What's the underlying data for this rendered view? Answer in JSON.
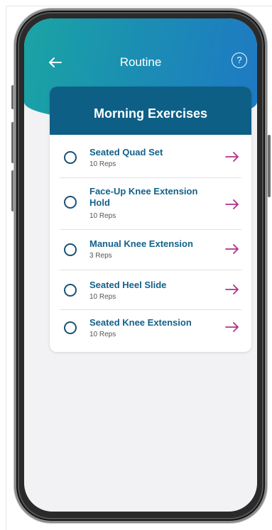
{
  "header": {
    "title": "Routine",
    "back_icon": "arrow-left-icon",
    "help_icon": "question-circle-icon",
    "help_glyph": "?"
  },
  "routine": {
    "title": "Morning Exercises",
    "exercises": [
      {
        "name": "Seated Quad Set",
        "reps": "10 Reps"
      },
      {
        "name": "Face-Up Knee Extension Hold",
        "reps": "10 Reps"
      },
      {
        "name": "Manual Knee Extension",
        "reps": "3 Reps"
      },
      {
        "name": "Seated Heel Slide",
        "reps": "10 Reps"
      },
      {
        "name": "Seated Knee Extension",
        "reps": "10 Reps"
      }
    ]
  },
  "colors": {
    "header_gradient": [
      "#1aa4a4",
      "#1e79c4"
    ],
    "card_header": "#0e5f86",
    "exercise_title": "#12618a",
    "arrow": "#b0308f"
  }
}
